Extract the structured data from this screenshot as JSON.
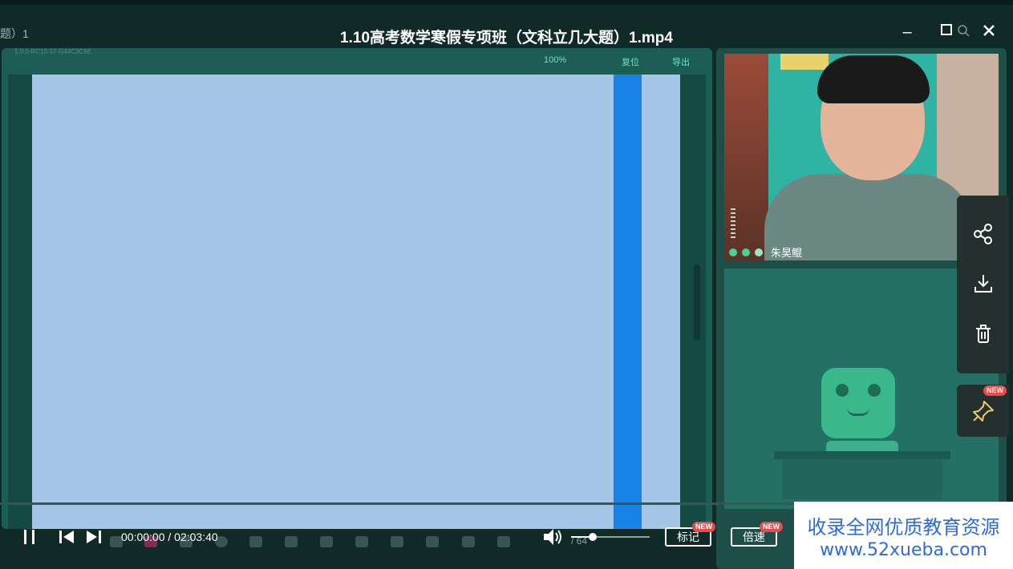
{
  "window": {
    "left_fragment": "题）1",
    "title": "1.10高考数学寒假专项班（文科立几大题）1.mp4",
    "minimize_label": "–",
    "maximize_label": "☐",
    "close_label": "✕"
  },
  "whiteboard": {
    "version": "1.0.0-RC15-37-G44C3C8E",
    "zoom": "100%",
    "reset_label": "复位",
    "export_label": "导出"
  },
  "video": {
    "teacher_name": "朱昊鲲"
  },
  "side_actions": [
    "share-icon",
    "download-icon",
    "delete-icon",
    "pin-icon"
  ],
  "pin_badge": "NEW",
  "player": {
    "current_time": "00:00:00",
    "separator": " / ",
    "total_time": "02:03:40",
    "page_indicator": "/ 64",
    "bookmark_label": "标记",
    "bookmark_badge": "NEW",
    "speed_label": "倍速",
    "speed_badge": "NEW"
  },
  "watermark": {
    "line1": "收录全网优质教育资源",
    "line2": "www.52xueba.com"
  },
  "colors": {
    "background": "#0f2a27",
    "board": "#a6c6e8",
    "accent_stripe": "#1782e8",
    "toolbar_text": "#6ee0c4",
    "badge": "#e84b4b",
    "watermark_text": "#2f6bd8"
  }
}
